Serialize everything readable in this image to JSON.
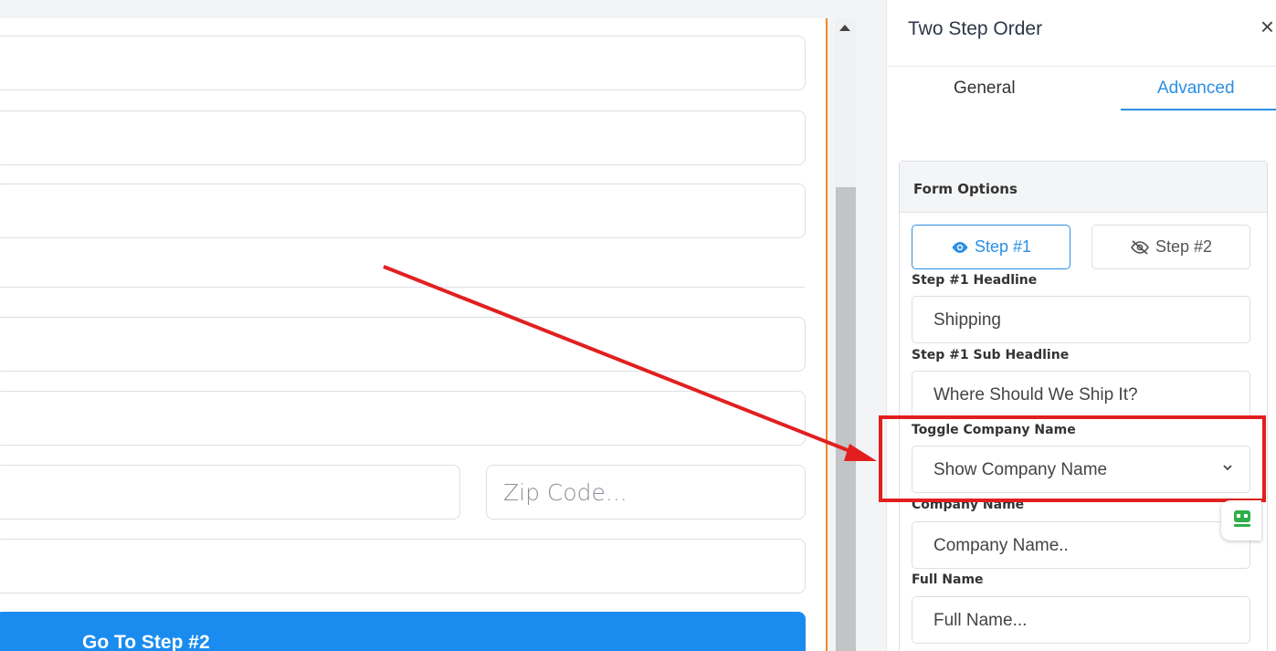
{
  "canvas": {
    "zip_placeholder": "Zip Code...",
    "go_button_label": "Go To Step #2"
  },
  "panel": {
    "title": "Two Step Order",
    "close_label": "×",
    "tabs": [
      {
        "label": "General",
        "active": false
      },
      {
        "label": "Advanced",
        "active": true
      }
    ],
    "form_options": {
      "title": "Form Options",
      "step1_label": "Step #1",
      "step2_label": "Step #2",
      "fields": {
        "headline_label": "Step #1 Headline",
        "headline_value": "Shipping",
        "subheadline_label": "Step #1 Sub Headline",
        "subheadline_value": "Where Should We Ship It?",
        "toggle_label": "Toggle Company Name",
        "toggle_value": "Show Company Name",
        "company_label": "Company Name",
        "company_value": "Company Name..",
        "fullname_label": "Full Name",
        "fullname_value": "Full Name..."
      }
    }
  },
  "colors": {
    "accent": "#2b8fe3",
    "button": "#1a8cf0",
    "highlight": "#e21f1f",
    "orange_guide": "#f08a24"
  },
  "icons": [
    "close-icon",
    "eye-icon",
    "eye-off-icon",
    "chevron-down-icon",
    "chat-bot-icon",
    "scroll-up-icon"
  ]
}
